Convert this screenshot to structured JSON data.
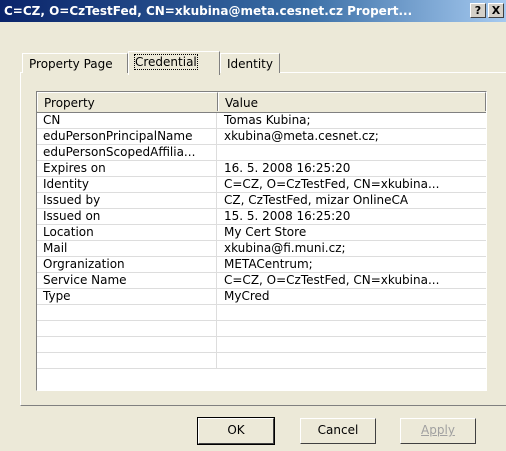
{
  "window": {
    "title": "C=CZ, O=CzTestFed, CN=xkubina@meta.cesnet.cz Propert...",
    "help_label": "?",
    "close_label": "X"
  },
  "tabs": [
    {
      "label": "Property Page"
    },
    {
      "label": "Credential"
    },
    {
      "label": "Identity"
    }
  ],
  "list": {
    "columns": [
      "Property",
      "Value"
    ],
    "rows": [
      [
        "CN",
        "Tomas Kubina;"
      ],
      [
        "eduPersonPrincipalName",
        "xkubina@meta.cesnet.cz;"
      ],
      [
        "eduPersonScopedAffilia...",
        ""
      ],
      [
        "Expires on",
        "16. 5. 2008 16:25:20"
      ],
      [
        "Identity",
        "C=CZ, O=CzTestFed, CN=xkubina..."
      ],
      [
        "Issued by",
        "CZ, CzTestFed, mizar OnlineCA"
      ],
      [
        "Issued on",
        "15. 5. 2008 16:25:20"
      ],
      [
        "Location",
        "My Cert Store"
      ],
      [
        "Mail",
        "xkubina@fi.muni.cz;"
      ],
      [
        "Orgranization",
        "METACentrum;"
      ],
      [
        "Service Name",
        "C=CZ, O=CzTestFed, CN=xkubina..."
      ],
      [
        "Type",
        "MyCred"
      ],
      [
        "",
        ""
      ],
      [
        "",
        ""
      ],
      [
        "",
        ""
      ],
      [
        "",
        ""
      ]
    ]
  },
  "buttons": {
    "ok": "OK",
    "cancel": "Cancel",
    "apply": "Apply"
  }
}
